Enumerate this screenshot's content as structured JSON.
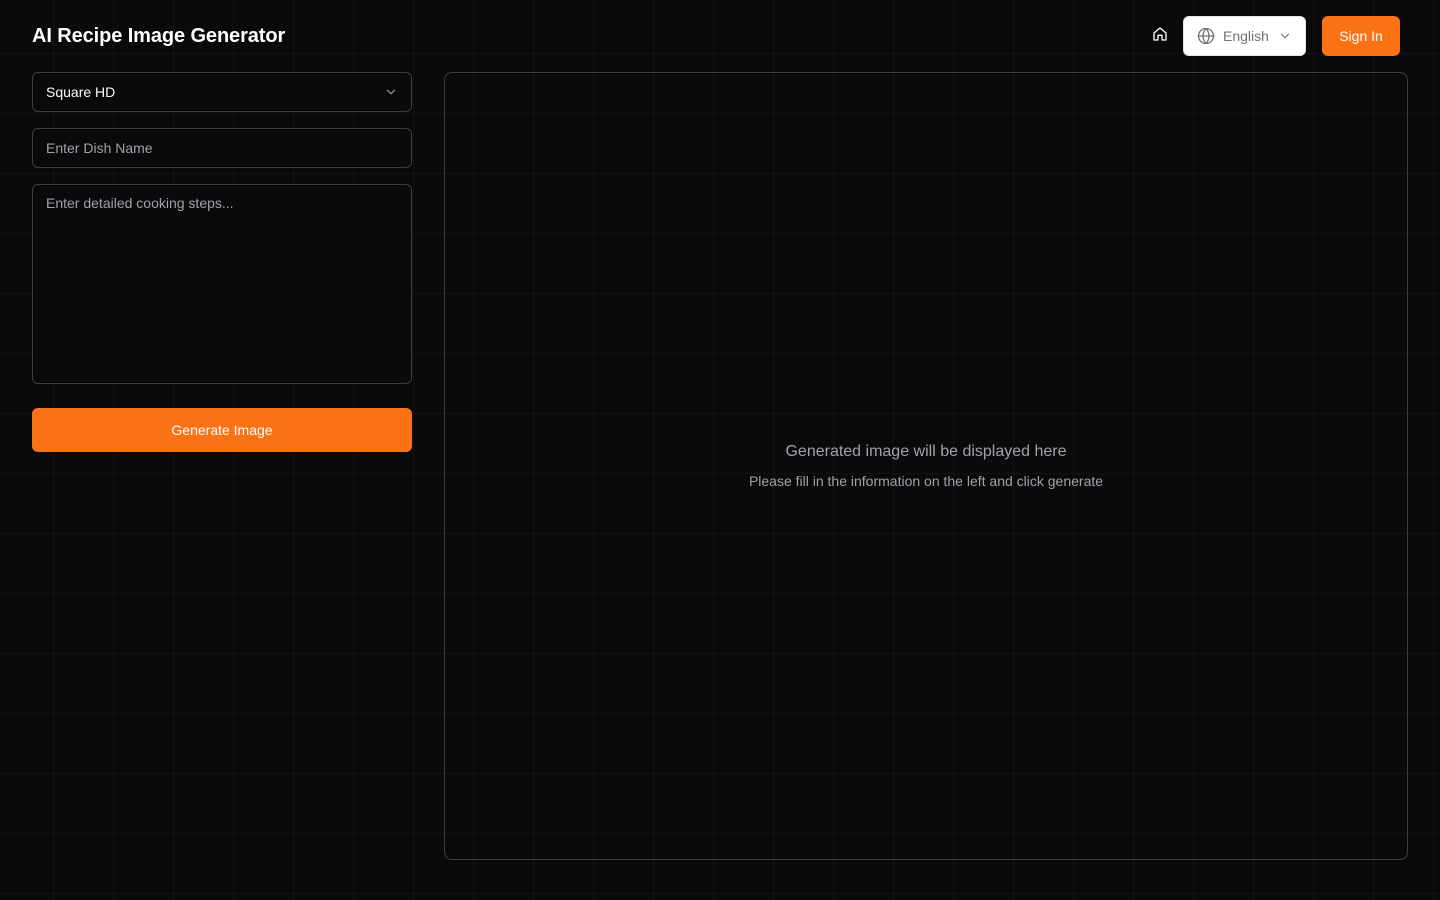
{
  "header": {
    "title": "AI Recipe Image Generator",
    "language": "English",
    "signin_label": "Sign In"
  },
  "form": {
    "image_size": "Square HD",
    "dish_placeholder": "Enter Dish Name",
    "steps_placeholder": "Enter detailed cooking steps...",
    "generate_label": "Generate Image"
  },
  "preview": {
    "title": "Generated image will be displayed here",
    "subtitle": "Please fill in the information on the left and click generate"
  },
  "icons": {
    "home": "home-icon",
    "globe": "globe-icon",
    "chevron": "chevron-down-icon"
  },
  "colors": {
    "accent": "#f97316",
    "background": "#0a0a0a",
    "border": "#3f3f46"
  }
}
